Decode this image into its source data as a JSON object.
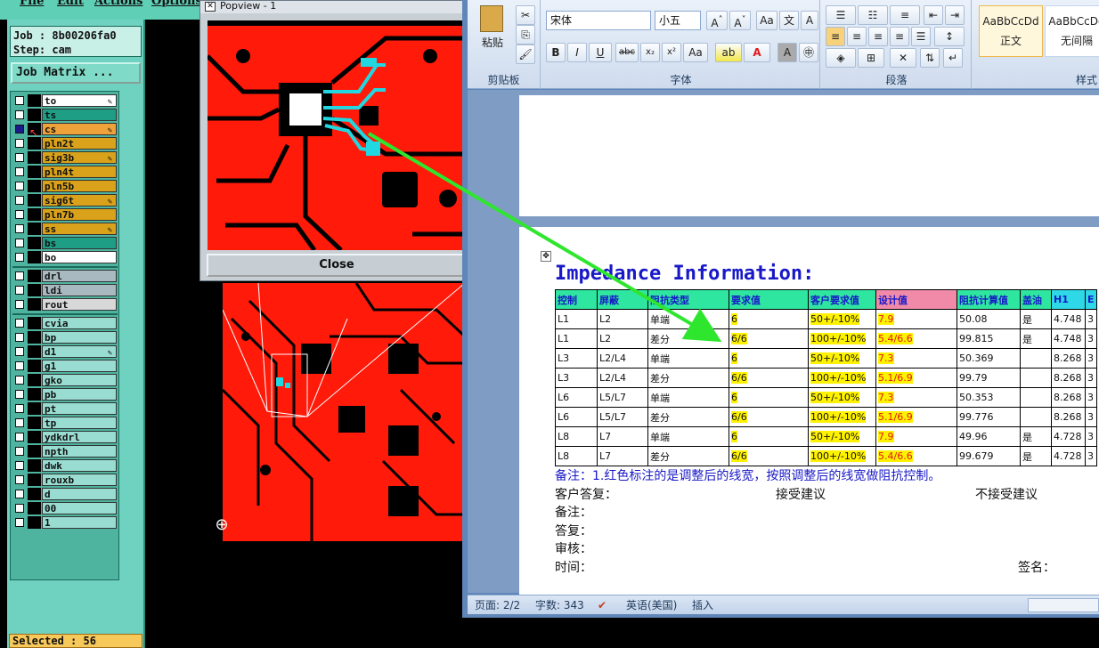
{
  "cam": {
    "menu": [
      "File",
      "Edit",
      "Actions",
      "Options"
    ],
    "job_label": "Job : 8b00206fa0",
    "step_label": "Step: cam",
    "job_matrix_button": "Job Matrix ...",
    "selected_label": "Selected : 56",
    "layers_group1": [
      {
        "name": "to",
        "color": "#ffffff",
        "write": true
      },
      {
        "name": "ts",
        "color": "#1f9e86",
        "write": false
      },
      {
        "name": "cs",
        "color": "#f0a23a",
        "write": true,
        "active": true
      },
      {
        "name": "pln2t",
        "color": "#d9a21a",
        "write": false
      },
      {
        "name": "sig3b",
        "color": "#d9a21a",
        "write": true
      },
      {
        "name": "pln4t",
        "color": "#d9a21a",
        "write": false
      },
      {
        "name": "pln5b",
        "color": "#d9a21a",
        "write": false
      },
      {
        "name": "sig6t",
        "color": "#d9a21a",
        "write": true
      },
      {
        "name": "pln7b",
        "color": "#d9a21a",
        "write": false
      },
      {
        "name": "ss",
        "color": "#d9a21a",
        "write": true
      },
      {
        "name": "bs",
        "color": "#1f9e86",
        "write": false
      },
      {
        "name": "bo",
        "color": "#ffffff",
        "write": false
      }
    ],
    "layers_group2": [
      {
        "name": "drl",
        "color": "#a9b9c0"
      },
      {
        "name": "ldi",
        "color": "#a9b9c0"
      },
      {
        "name": "rout",
        "color": "#d8d8d8"
      }
    ],
    "layers_group3": [
      {
        "name": "cvia",
        "color": "#99ddd2"
      },
      {
        "name": "bp",
        "color": "#99ddd2"
      },
      {
        "name": "d1",
        "color": "#99ddd2",
        "write": true
      },
      {
        "name": "g1",
        "color": "#99ddd2"
      },
      {
        "name": "gko",
        "color": "#99ddd2"
      },
      {
        "name": "pb",
        "color": "#99ddd2"
      },
      {
        "name": "pt",
        "color": "#99ddd2"
      },
      {
        "name": "tp",
        "color": "#99ddd2"
      },
      {
        "name": "ydkdrl",
        "color": "#99ddd2"
      },
      {
        "name": "npth",
        "color": "#99ddd2"
      },
      {
        "name": "dwk",
        "color": "#99ddd2"
      },
      {
        "name": "rouxb",
        "color": "#99ddd2"
      },
      {
        "name": "d",
        "color": "#99ddd2"
      },
      {
        "name": "00",
        "color": "#99ddd2"
      },
      {
        "name": "1",
        "color": "#99ddd2"
      }
    ]
  },
  "popview": {
    "title": "Popview - 1",
    "close_button": "Close"
  },
  "word": {
    "clipboard": {
      "paste_label": "粘贴",
      "group": "剪贴板"
    },
    "font": {
      "font_name": "宋体",
      "font_size": "小五",
      "group": "字体"
    },
    "paragraph": {
      "group": "段落"
    },
    "styles": {
      "style1": "正文",
      "style2": "无间隔",
      "sample": "AaBbCcDd",
      "group": "样式"
    },
    "doc_title": "Impedance Information:",
    "table": {
      "headers": [
        "控制",
        "屏蔽",
        "阻抗类型",
        "要求值",
        "客户要求值",
        "设计值",
        "阻抗计算值",
        "盖油",
        "H1",
        "E"
      ],
      "rows": [
        [
          "L1",
          "L2",
          "单端",
          "6",
          "50+/-10%",
          "7.9",
          "50.08",
          "是",
          "4.748",
          "3"
        ],
        [
          "L1",
          "L2",
          "差分",
          "6/6",
          "100+/-10%",
          "5.4/6.6",
          "99.815",
          "是",
          "4.748",
          "3"
        ],
        [
          "L3",
          "L2/L4",
          "单端",
          "6",
          "50+/-10%",
          "7.3",
          "50.369",
          "",
          "8.268",
          "3"
        ],
        [
          "L3",
          "L2/L4",
          "差分",
          "6/6",
          "100+/-10%",
          "5.1/6.9",
          "99.79",
          "",
          "8.268",
          "3"
        ],
        [
          "L6",
          "L5/L7",
          "单端",
          "6",
          "50+/-10%",
          "7.3",
          "50.353",
          "",
          "8.268",
          "3"
        ],
        [
          "L6",
          "L5/L7",
          "差分",
          "6/6",
          "100+/-10%",
          "5.1/6.9",
          "99.776",
          "",
          "8.268",
          "3"
        ],
        [
          "L8",
          "L7",
          "单端",
          "6",
          "50+/-10%",
          "7.9",
          "49.96",
          "是",
          "4.728",
          "3"
        ],
        [
          "L8",
          "L7",
          "差分",
          "6/6",
          "100+/-10%",
          "5.4/6.6",
          "99.679",
          "是",
          "4.728",
          "3"
        ]
      ]
    },
    "notes": {
      "remark": "备注：1.红色标注的是调整后的线宽，按照调整后的线宽做阻抗控制。",
      "customer_reply": "客户答复：",
      "accept": "接受建议",
      "reject": "不接受建议",
      "remark2": "备注：",
      "answer": "答复：",
      "review": "审核：",
      "time": "时间：",
      "sign": "签名："
    },
    "status": {
      "page": "页面: 2/2",
      "words": "字数: 343",
      "language": "英语(美国)",
      "insert": "插入"
    }
  },
  "colors": {
    "pcb_red": "#ff1a0a",
    "arrow_green": "#2ee62e",
    "trace_cyan": "#22d8e0"
  }
}
